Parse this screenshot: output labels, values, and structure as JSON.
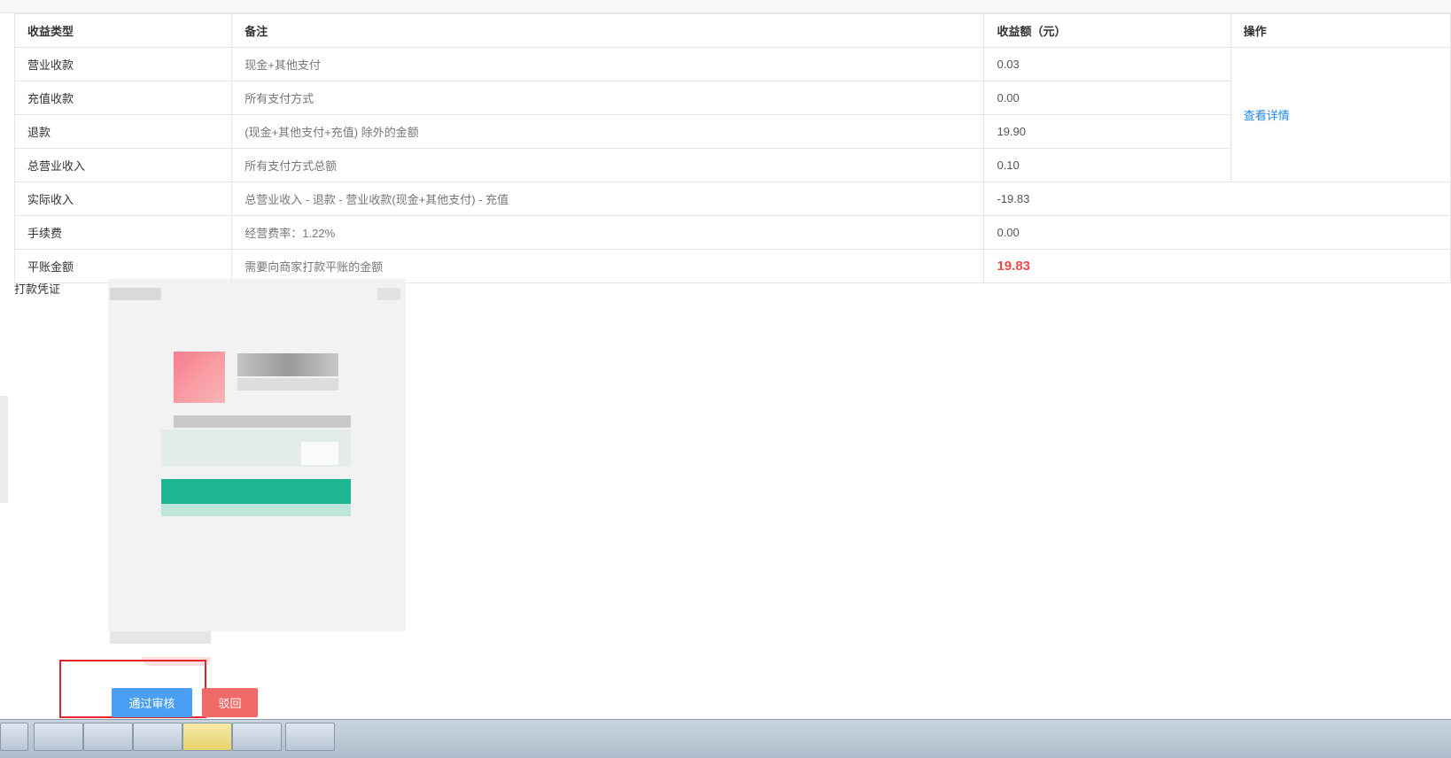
{
  "table": {
    "headers": [
      "收益类型",
      "备注",
      "收益额（元）",
      "操作"
    ],
    "rows": [
      {
        "type": "营业收款",
        "note": "现金+其他支付",
        "amount": "0.03"
      },
      {
        "type": "充值收款",
        "note": "所有支付方式",
        "amount": "0.00"
      },
      {
        "type": "退款",
        "note": "(现金+其他支付+充值) 除外的金额",
        "amount": "19.90"
      },
      {
        "type": "总营业收入",
        "note": "所有支付方式总额",
        "amount": "0.10"
      },
      {
        "type": "实际收入",
        "note": "总营业收入 - 退款 - 营业收款(现金+其他支付) - 充值",
        "amount": "-19.83"
      },
      {
        "type": "手续费",
        "note": "经营费率：1.22%",
        "amount": "0.00"
      },
      {
        "type": "平账金额",
        "note": "需要向商家打款平账的金额",
        "amount": "19.83"
      }
    ],
    "action_link": "查看详情"
  },
  "proof": {
    "label": "打款凭证"
  },
  "actions": {
    "approve_label": "通过审核",
    "reject_label": "驳回"
  },
  "colors": {
    "link": "#1e88e5",
    "highlight_amount": "#f04b4b",
    "approve_button": "#4a9ff5",
    "reject_button": "#f06a6a",
    "annotation_box": "#e5252a"
  }
}
